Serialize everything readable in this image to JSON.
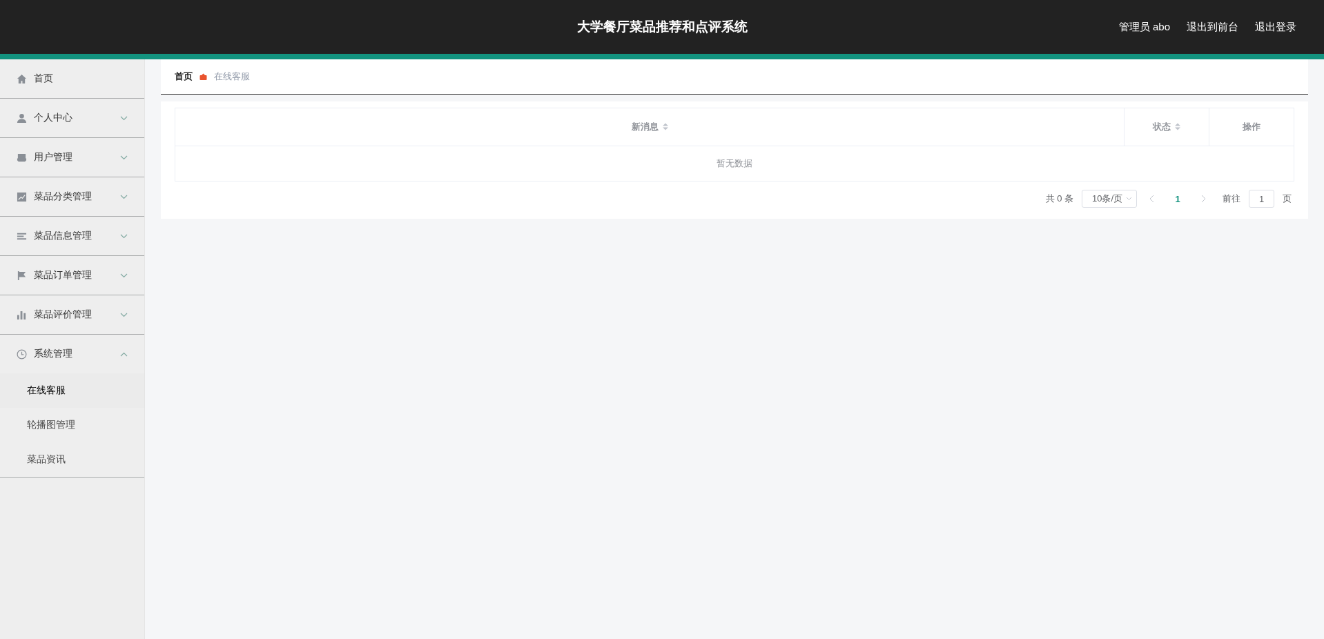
{
  "header": {
    "title": "大学餐厅菜品推荐和点评系统",
    "links": [
      "管理员 abo",
      "退出到前台",
      "退出登录"
    ]
  },
  "sidebar": {
    "items": [
      {
        "label": "首页",
        "kind": "home"
      },
      {
        "label": "个人中心",
        "kind": "user",
        "expanded": false
      },
      {
        "label": "用户管理",
        "kind": "tray",
        "expanded": false
      },
      {
        "label": "菜品分类管理",
        "kind": "chart",
        "expanded": false
      },
      {
        "label": "菜品信息管理",
        "kind": "list",
        "expanded": false
      },
      {
        "label": "菜品订单管理",
        "kind": "flag",
        "expanded": false
      },
      {
        "label": "菜品评价管理",
        "kind": "bars",
        "expanded": false
      },
      {
        "label": "系统管理",
        "kind": "clock",
        "expanded": true,
        "children": [
          {
            "label": "在线客服",
            "selected": true
          },
          {
            "label": "轮播图管理",
            "selected": false
          },
          {
            "label": "菜品资讯",
            "selected": false
          }
        ]
      }
    ]
  },
  "breadcrumb": [
    "首页",
    "在线客服"
  ],
  "table": {
    "columns": [
      {
        "label": "新消息",
        "sortable": true
      },
      {
        "label": "状态",
        "sortable": true
      },
      {
        "label": "操作",
        "sortable": false
      }
    ],
    "empty_text": "暂无数据"
  },
  "pagination": {
    "total": "共 0 条",
    "page_size": "10条/页",
    "pages": [
      {
        "label": "1",
        "selected": true
      }
    ],
    "goto_label": "前往",
    "goto_value": "1",
    "goto_suffix": "页"
  }
}
